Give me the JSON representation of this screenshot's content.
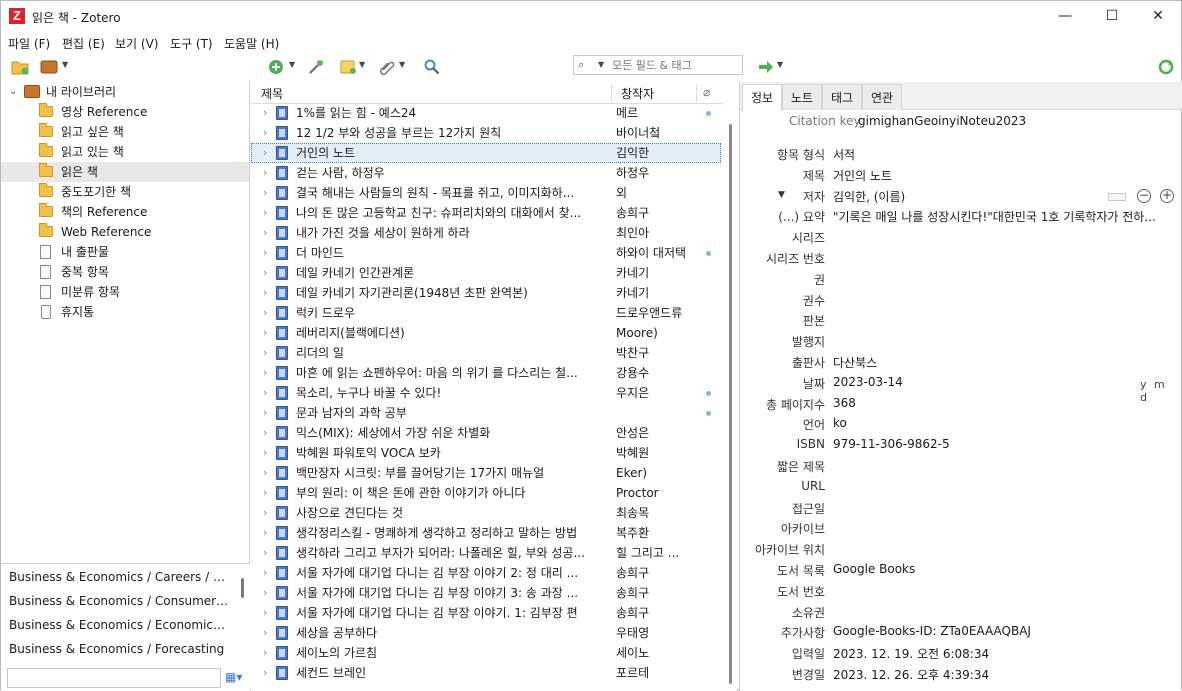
{
  "window": {
    "title": "읽은 책 - Zotero",
    "logo": "Z",
    "min_glyph": "—",
    "max_glyph": "☐",
    "close_glyph": "✕"
  },
  "menu": [
    "파일 (F)",
    "편집 (E)",
    "보기 (V)",
    "도구 (T)",
    "도움말 (H)"
  ],
  "search": {
    "placeholder": "모든 필드 & 태그"
  },
  "collections": {
    "library": "내 라이브러리",
    "items": [
      "영상 Reference",
      "읽고 싶은 책",
      "읽고 있는 책",
      "읽은 책",
      "중도포기한 책",
      "책의 Reference",
      "Web Reference"
    ],
    "special": [
      "내 출판물",
      "중복 항목",
      "미분류 항목",
      "휴지통"
    ],
    "selected": "읽은 책"
  },
  "tags": [
    "Business & Economics / Careers / Ge...",
    "Business & Economics / Consumer Be...",
    "Business & Economics / Economics / ...",
    "Business & Economics / Forecasting"
  ],
  "items_header": {
    "title": "제목",
    "creator": "창작자"
  },
  "items": [
    {
      "title": "1%를 읽는 힘 - 예스24",
      "creator": "메르",
      "dot": true
    },
    {
      "title": "12 1/2 부와 성공을 부르는 12가지 원칙",
      "creator": "바이너첰",
      "dot": false
    },
    {
      "title": "거인의 노트",
      "creator": "김익한",
      "dot": false,
      "selected": true
    },
    {
      "title": "걷는 사람, 하정우",
      "creator": "하정우",
      "dot": false
    },
    {
      "title": "결국 해내는 사람들의 원칙 - 목표를 쥐고, 이미지화하...",
      "creator": "외",
      "dot": false
    },
    {
      "title": "나의 돈 많은 고등학교 친구: 슈퍼리치와의 대화에서 찾...",
      "creator": "송희구",
      "dot": false
    },
    {
      "title": "내가 가진 것을 세상이 원하게 하라",
      "creator": "최인아",
      "dot": false
    },
    {
      "title": "더 마인드",
      "creator": "하와이 대저택",
      "dot": true
    },
    {
      "title": "데일 카네기 인간관계론",
      "creator": "카네기",
      "dot": false
    },
    {
      "title": "데일 카네기 자기관리론(1948년 초판 완역본)",
      "creator": "카네기",
      "dot": false
    },
    {
      "title": "럭키 드로우",
      "creator": "드로우앤드류",
      "dot": false
    },
    {
      "title": "레버리지(블랙에디션)",
      "creator": "Moore)",
      "dot": false
    },
    {
      "title": "리더의 일",
      "creator": "박찬구",
      "dot": false
    },
    {
      "title": "마흔 에 읽는 쇼펜하우어: 마음 의 위기 를 다스리는 철...",
      "creator": "강용수",
      "dot": false
    },
    {
      "title": "목소리, 누구나 바꿀 수 있다!",
      "creator": "우지은",
      "dot": true
    },
    {
      "title": "문과 남자의 과학 공부",
      "creator": "",
      "dot": true
    },
    {
      "title": "믹스(MIX): 세상에서 가장 쉬운 차별화",
      "creator": "안성은",
      "dot": false
    },
    {
      "title": "박혜원 파워토익 VOCA 보카",
      "creator": "박혜원",
      "dot": false
    },
    {
      "title": "백만장자 시크릿: 부를 끌어당기는 17가지 매뉴얼",
      "creator": "Eker)",
      "dot": false
    },
    {
      "title": "부의 원리: 이 책은 돈에 관한 이야기가 아니다",
      "creator": "Proctor",
      "dot": false
    },
    {
      "title": "사장으로 견딘다는 것",
      "creator": "최송목",
      "dot": false
    },
    {
      "title": "생각정리스킬 - 명쾌하게 생각하고 정리하고 말하는 방법",
      "creator": "복주환",
      "dot": false
    },
    {
      "title": "생각하라 그리고 부자가 되어라: 나폴레온 힐, 부와 성공...",
      "creator": "힐 그리고 ...",
      "dot": false
    },
    {
      "title": "서울 자가에 대기업 다니는 김 부장 이야기 2: 정 대리 ...",
      "creator": "송희구",
      "dot": false
    },
    {
      "title": "서울 자가에 대기업 다니는 김 부장 이야기 3: 송 과장 ...",
      "creator": "송희구",
      "dot": false
    },
    {
      "title": "서울 자가에 대기업 다니는 김 부장 이야기. 1: 김부장 편",
      "creator": "송희구",
      "dot": false
    },
    {
      "title": "세상을 공부하다",
      "creator": "우태영",
      "dot": false
    },
    {
      "title": "세이노의 가르침",
      "creator": "세이노",
      "dot": false
    },
    {
      "title": "세컨드 브레인",
      "creator": "포르테",
      "dot": false
    }
  ],
  "tabs": [
    "정보",
    "노트",
    "태그",
    "연관"
  ],
  "info": {
    "citation_key_label": "Citation key",
    "citation_key": "gimighanGeoinyiNoteu2023",
    "fields": [
      {
        "label": "항목 형식",
        "value": "서적"
      },
      {
        "label": "제목",
        "value": "거인의 노트"
      },
      {
        "label": "저자",
        "value": "김익한, (이름)"
      },
      {
        "label": "(...) 요약",
        "value": "\"기록은 매일 나를 성장시킨다!\"대한민국 1호 기록학자가 전하..."
      },
      {
        "label": "시리즈",
        "value": ""
      },
      {
        "label": "시리즈 번호",
        "value": ""
      },
      {
        "label": "권",
        "value": ""
      },
      {
        "label": "권수",
        "value": ""
      },
      {
        "label": "판본",
        "value": ""
      },
      {
        "label": "발행지",
        "value": ""
      },
      {
        "label": "출판사",
        "value": "다산북스"
      },
      {
        "label": "날짜",
        "value": "2023-03-14"
      },
      {
        "label": "총 페이지수",
        "value": "368"
      },
      {
        "label": "언어",
        "value": "ko"
      },
      {
        "label": "ISBN",
        "value": "979-11-306-9862-5"
      },
      {
        "label": "짧은 제목",
        "value": ""
      },
      {
        "label": "URL",
        "value": ""
      },
      {
        "label": "접근일",
        "value": ""
      },
      {
        "label": "아카이브",
        "value": ""
      },
      {
        "label": "아카이브 위치",
        "value": ""
      },
      {
        "label": "도서 목록",
        "value": "Google Books"
      },
      {
        "label": "도서 번호",
        "value": ""
      },
      {
        "label": "소유권",
        "value": ""
      },
      {
        "label": "추가사항",
        "value": "Google-Books-ID: ZTa0EAAAQBAJ"
      },
      {
        "label": "입력일",
        "value": "2023. 12. 19. 오전 6:08:34"
      },
      {
        "label": "변경일",
        "value": "2023. 12. 26. 오후 4:39:34"
      }
    ],
    "date_format": "y m d"
  },
  "colors": {
    "accent": "#3a7bd5",
    "selection": "#e3eef9",
    "folder": "#f3c14b",
    "book": "#4d79c6",
    "logo": "#d6262c"
  }
}
